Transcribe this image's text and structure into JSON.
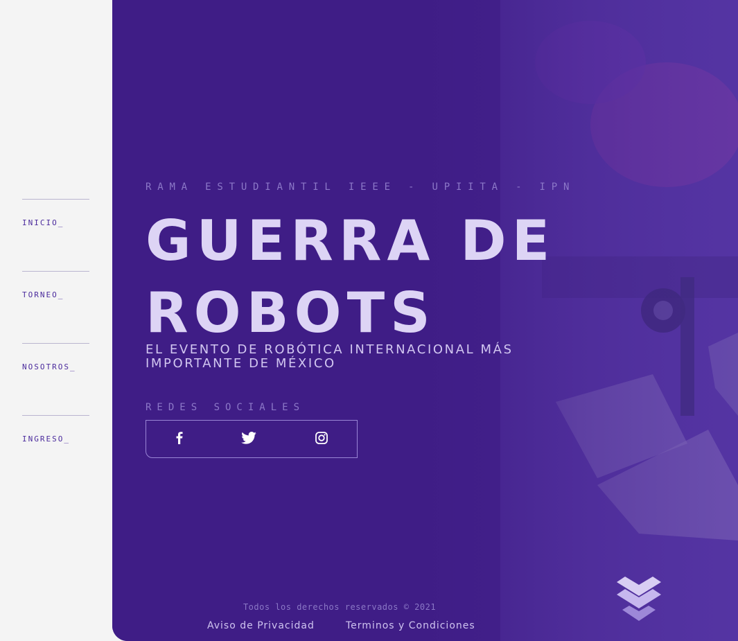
{
  "sidebar": {
    "items": [
      {
        "label": "INICIO_"
      },
      {
        "label": "TORNEO_"
      },
      {
        "label": "NOSOTROS_"
      },
      {
        "label": "INGRESO_"
      }
    ]
  },
  "hero": {
    "kicker": "RAMA ESTUDIANTIL IEEE - UPIITA - IPN",
    "title": "GUERRA DE ROBOTS",
    "subtitle": "EL EVENTO DE ROBÓTICA INTERNACIONAL MÁS IMPORTANTE DE MÉXICO",
    "social_label": "REDES SOCIALES",
    "social_icons": [
      "facebook-icon",
      "twitter-icon",
      "instagram-icon"
    ],
    "scroll_icon": "chevron-double-down-icon"
  },
  "footer": {
    "copyright": "Todos los derechos reservados © 2021",
    "privacy": "Aviso de Privacidad",
    "terms": "Terminos y Condiciones"
  },
  "colors": {
    "sidebar_bg": "#f4f4f4",
    "hero_bg": "#3f1d86",
    "nav_text": "#4a2a9c",
    "title_text": "#ddd4f5",
    "muted_text": "#8c78c8"
  }
}
